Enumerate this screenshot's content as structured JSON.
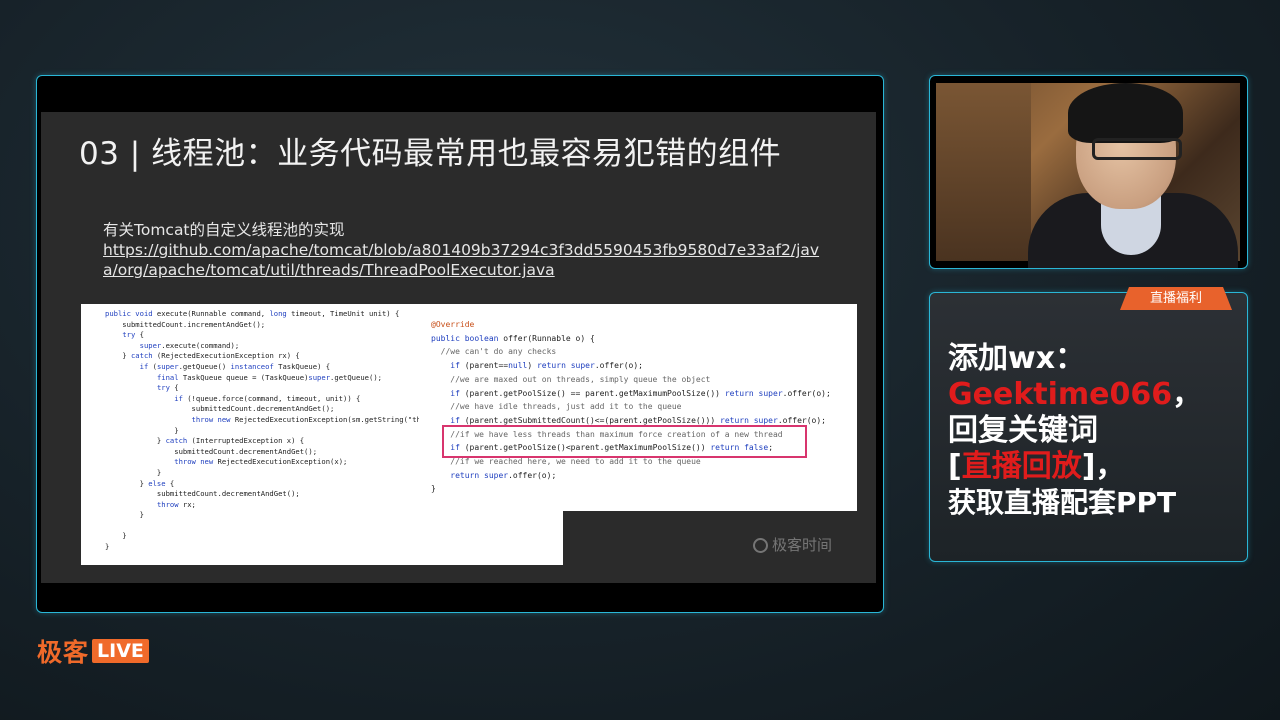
{
  "slide": {
    "title": "03 | 线程池：业务代码最常用也最容易犯错的组件",
    "subtitle": "有关Tomcat的自定义线程池的实现",
    "link": "https://github.com/apache/tomcat/blob/a801409b37294c3f3dd5590453fb9580d7e33af2/java/org/apache/tomcat/util/threads/ThreadPoolExecutor.java",
    "watermark": "极客时间"
  },
  "code_left": [
    "public void execute(Runnable command, long timeout, TimeUnit unit) {",
    "    submittedCount.incrementAndGet();",
    "    try {",
    "        super.execute(command);",
    "    } catch (RejectedExecutionException rx) {",
    "        if (super.getQueue() instanceof TaskQueue) {",
    "            final TaskQueue queue = (TaskQueue)super.getQueue();",
    "            try {",
    "                if (!queue.force(command, timeout, unit)) {",
    "                    submittedCount.decrementAndGet();",
    "                    throw new RejectedExecutionException(sm.getString(\"threadPo",
    "                }",
    "            } catch (InterruptedException x) {",
    "                submittedCount.decrementAndGet();",
    "                throw new RejectedExecutionException(x);",
    "            }",
    "        } else {",
    "            submittedCount.decrementAndGet();",
    "            throw rx;",
    "        }",
    "",
    "    }",
    "}"
  ],
  "code_right": [
    "@Override",
    "public boolean offer(Runnable o) {",
    "  //we can't do any checks",
    "    if (parent==null) return super.offer(o);",
    "    //we are maxed out on threads, simply queue the object",
    "    if (parent.getPoolSize() == parent.getMaximumPoolSize()) return super.offer(o);",
    "    //we have idle threads, just add it to the queue",
    "    if (parent.getSubmittedCount()<=(parent.getPoolSize())) return super.offer(o);",
    "    //if we have less threads than maximum force creation of a new thread",
    "    if (parent.getPoolSize()<parent.getMaximumPoolSize()) return false;",
    "    //if we reached here, we need to add it to the queue",
    "    return super.offer(o);",
    "}"
  ],
  "promo": {
    "tab": "直播福利",
    "line1": "添加wx：",
    "line2": "Geektime066",
    "line2_suffix": "，",
    "line3": "回复关键词",
    "line4_open": "[",
    "line4_red": "直播回放",
    "line4_close": "]，",
    "line5": "获取直播配套PPT"
  },
  "brand": {
    "cn": "极客",
    "live": "LIVE"
  },
  "colors": {
    "panel_border": "#2ab6d6",
    "brand_orange": "#f06a2a",
    "promo_red": "#e01c1c",
    "highlight": "#d8356e"
  }
}
